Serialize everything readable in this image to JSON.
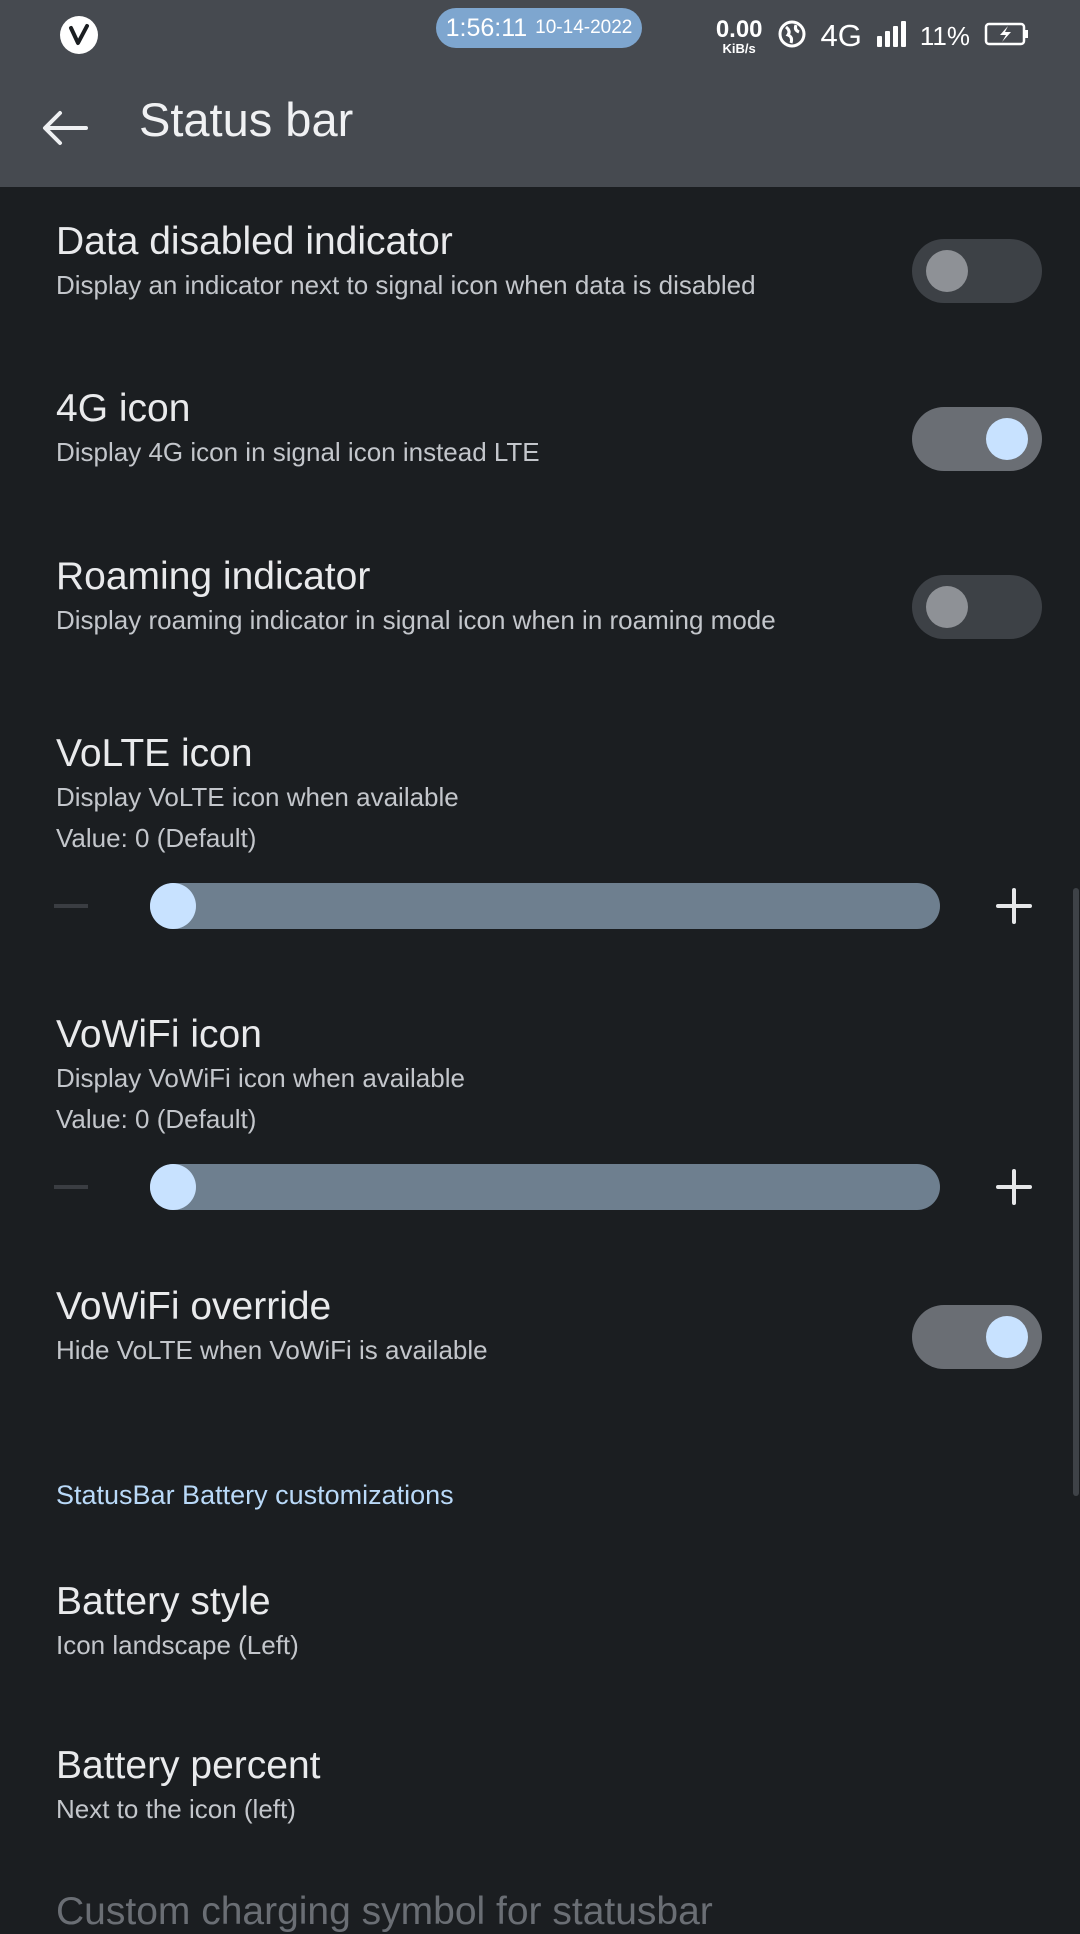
{
  "status_bar": {
    "time": "1:56:11",
    "date": "10-14-2022",
    "speed_value": "0.00",
    "speed_unit": "KiB/s",
    "network": "4G",
    "battery_percent": "11%"
  },
  "app_bar": {
    "title": "Status bar"
  },
  "settings": {
    "data_disabled": {
      "title": "Data disabled indicator",
      "summary": "Display an indicator next to signal icon when data is disabled",
      "enabled": false
    },
    "icon_4g": {
      "title": "4G icon",
      "summary": "Display 4G icon in signal icon instead LTE",
      "enabled": true
    },
    "roaming": {
      "title": "Roaming indicator",
      "summary": "Display roaming indicator in signal icon when in roaming mode",
      "enabled": false
    },
    "volte": {
      "title": "VoLTE icon",
      "summary": "Display VoLTE icon when available",
      "value_text": "Value: 0  (Default)",
      "value": 0
    },
    "vowifi": {
      "title": "VoWiFi icon",
      "summary": "Display VoWiFi icon when available",
      "value_text": "Value: 0  (Default)",
      "value": 0
    },
    "vowifi_override": {
      "title": "VoWiFi override",
      "summary": "Hide VoLTE when VoWiFi is available",
      "enabled": true
    }
  },
  "battery_section": {
    "header": "StatusBar Battery customizations",
    "battery_style": {
      "title": "Battery style",
      "summary": "Icon landscape (Left)"
    },
    "battery_percent": {
      "title": "Battery percent",
      "summary": "Next to the icon (left)"
    },
    "cutoff_item": "Custom charging symbol for statusbar"
  },
  "colors": {
    "background": "#1b1e21",
    "app_bar": "#464a50",
    "accent": "#c8e2ff",
    "clock_pill": "#7ea6cf",
    "slider_track": "#6e7f8f"
  },
  "icons": {
    "logo": "v-logo-icon",
    "vpn": "globe-icon",
    "signal": "signal-bars-icon",
    "battery": "battery-charging-icon",
    "back": "arrow-left-icon",
    "minus": "minus-icon",
    "plus": "plus-icon"
  }
}
